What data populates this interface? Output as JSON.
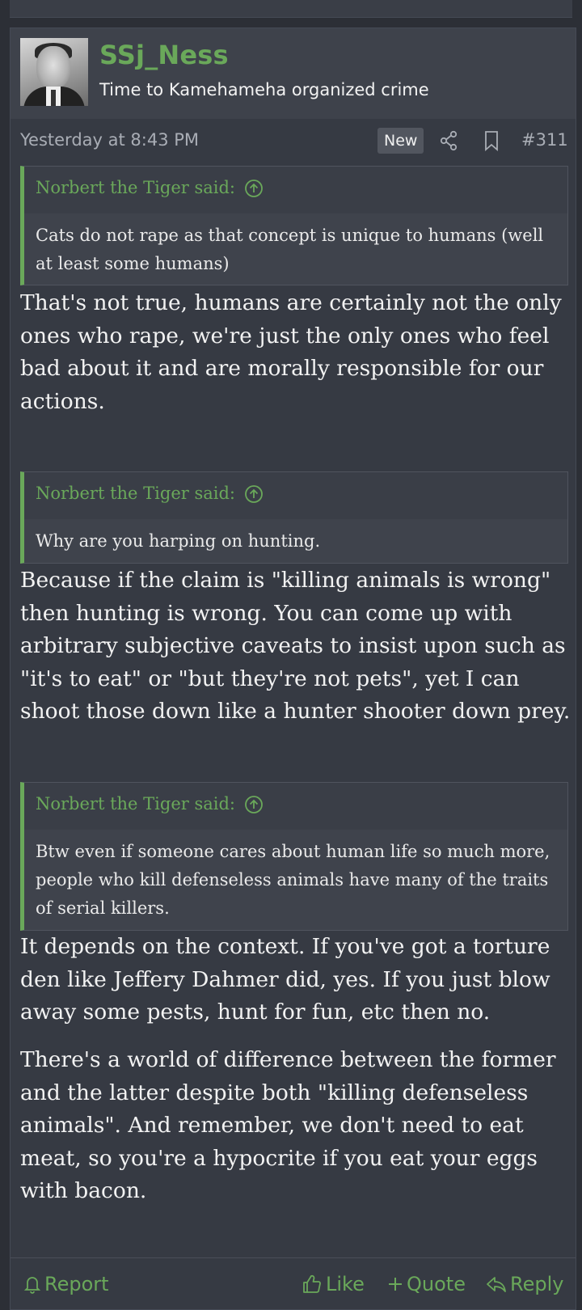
{
  "post": {
    "username": "SSj_Ness",
    "user_title": "Time to Kamehameha organized crime",
    "timestamp": "Yesterday at 8:43 PM",
    "new_badge": "New",
    "post_number": "#311"
  },
  "quotes": [
    {
      "author": "Norbert the Tiger said:",
      "text": "Cats do not rape as that concept is unique to humans (well at least some humans)"
    },
    {
      "author": "Norbert the Tiger said:",
      "text": "Why are you harping on hunting."
    },
    {
      "author": "Norbert the Tiger said:",
      "text": "Btw even if someone cares about human life so much more, people who kill defenseless animals have many of the traits of serial killers."
    }
  ],
  "replies": [
    "That's not true, humans are certainly not the only ones who rape, we're just the only ones who feel bad about it and are morally responsible for our actions.",
    "Because if the claim is \"killing animals is wrong\" then hunting is wrong. You can come up with arbitrary subjective caveats to insist upon such as \"it's to eat\" or \"but they're not pets\", yet I can shoot those down like a hunter shooter down prey.",
    "It depends on the context. If you've got a torture den like Jeffery Dahmer did, yes. If you just blow away some pests, hunt for fun, etc then no.",
    "There's a world of difference between the former and the latter despite both \"killing defenseless animals\". And remember, we don't need to eat meat, so you're a hypocrite if you eat your eggs with bacon."
  ],
  "footer": {
    "report": "Report",
    "like": "Like",
    "quote": "Quote",
    "reply": "Reply"
  },
  "icons": {
    "share": "share-icon",
    "bookmark": "bookmark-icon",
    "quote_arrow": "arrow-up-circle-icon",
    "report": "bell-icon",
    "like": "thumbs-up-icon",
    "quote": "plus-icon",
    "reply": "reply-arrow-icon"
  },
  "colors": {
    "accent": "#6aa85a",
    "background": "#2c2f36",
    "post_background": "#363a43"
  }
}
